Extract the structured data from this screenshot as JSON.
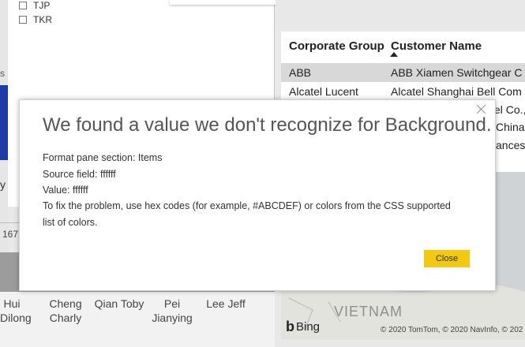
{
  "slicer": {
    "items": [
      {
        "label": "TJP"
      },
      {
        "label": "TKR"
      }
    ]
  },
  "left_fragments": {
    "s_text": "s",
    "y_text": "y",
    "number_text": "167"
  },
  "team_names": [
    {
      "line1": "Hui",
      "line2": "Dilong"
    },
    {
      "line1": "Cheng",
      "line2": "Charly"
    },
    {
      "line1": "Qian Toby",
      "line2": ""
    },
    {
      "line1": "Pei",
      "line2": "Jianying"
    },
    {
      "line1": "Lee Jeff",
      "line2": ""
    }
  ],
  "table": {
    "headers": [
      "Corporate Group",
      "Customer Name"
    ],
    "rows": [
      [
        "ABB",
        "ABB Xiamen Switchgear C"
      ],
      [
        "Alcatel Lucent",
        "Alcatel Shanghai Bell Com"
      ],
      [
        "",
        "el Co.,"
      ],
      [
        "",
        "China"
      ],
      [
        "",
        "ances"
      ]
    ]
  },
  "map": {
    "country_label": "VIETNAM",
    "bing_label": "Bing",
    "copyright": "© 2020 TomTom, © 2020 NavInfo, © 202"
  },
  "dialog": {
    "title": "We found a value we don't recognize for Background.",
    "lines": [
      "Format pane section: Items",
      "Source field: ffffff",
      "Value: ffffff",
      "To fix the problem, use hex codes (for example, #ABCDEF) or colors from the CSS supported",
      "list of colors."
    ],
    "close_button": "Close"
  },
  "colors": {
    "accent_button": "#f2c811",
    "slicer_blue": "#1f3ba5",
    "selected_row": "#d8d8d8"
  }
}
